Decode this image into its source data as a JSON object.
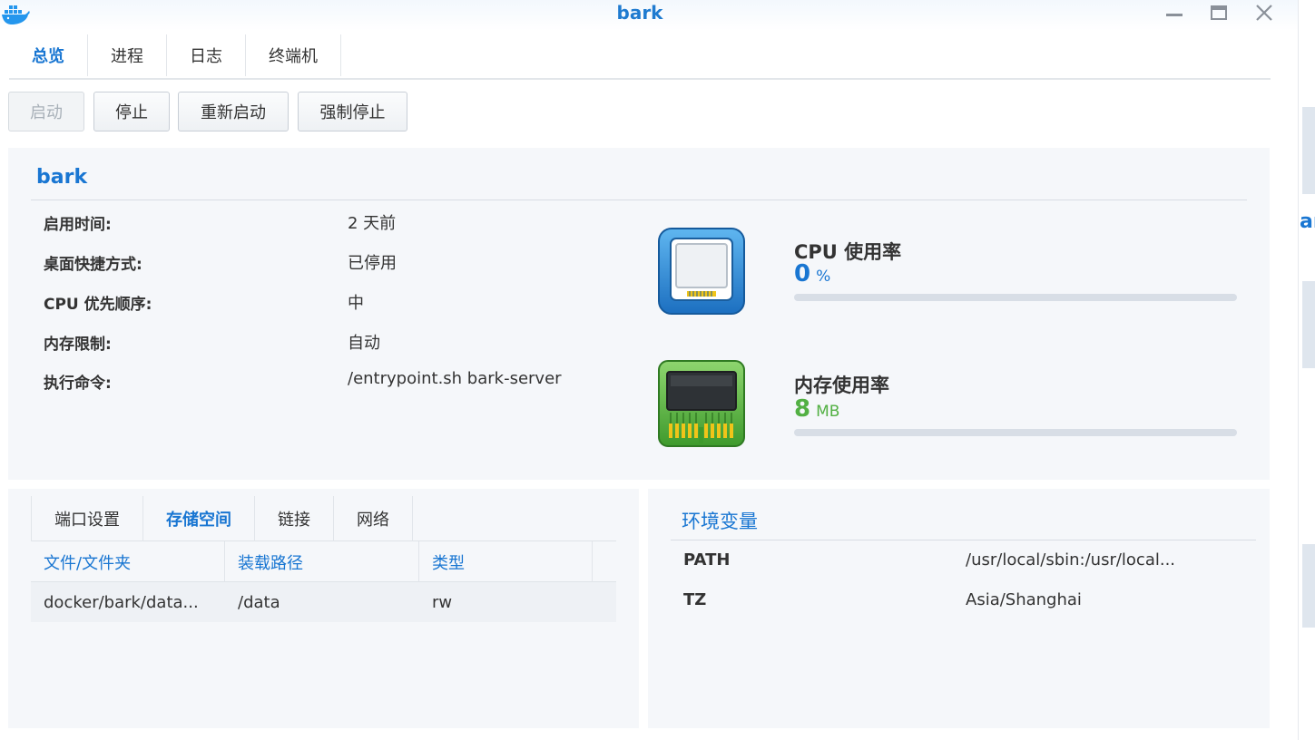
{
  "window": {
    "title": "bark",
    "app_icon": "docker-whale-icon",
    "controls": [
      "minimize-icon",
      "maximize-icon",
      "close-icon"
    ]
  },
  "tabs": [
    {
      "label": "总览",
      "active": true
    },
    {
      "label": "进程",
      "active": false
    },
    {
      "label": "日志",
      "active": false
    },
    {
      "label": "终端机",
      "active": false
    }
  ],
  "toolbar": {
    "start_label": "启动",
    "start_disabled": true,
    "stop_label": "停止",
    "restart_label": "重新启动",
    "force_stop_label": "强制停止"
  },
  "overview": {
    "name": "bark",
    "properties": [
      {
        "label": "启用时间:",
        "value": "2 天前"
      },
      {
        "label": "桌面快捷方式:",
        "value": "已停用"
      },
      {
        "label": "CPU 优先顺序:",
        "value": "中"
      },
      {
        "label": "内存限制:",
        "value": "自动"
      },
      {
        "label": "执行命令:",
        "value": "/entrypoint.sh bark-server"
      }
    ],
    "cpu": {
      "title": "CPU 使用率",
      "value": "0",
      "unit": "%",
      "percent": 0,
      "icon": "cpu-chip-icon",
      "color": "#1976d2"
    },
    "memory": {
      "title": "内存使用率",
      "value": "8",
      "unit": "MB",
      "percent": 0,
      "icon": "memory-module-icon",
      "color": "#52b043"
    }
  },
  "storage": {
    "tabs": [
      {
        "label": "端口设置",
        "active": false
      },
      {
        "label": "存储空间",
        "active": true
      },
      {
        "label": "链接",
        "active": false
      },
      {
        "label": "网络",
        "active": false
      }
    ],
    "columns": [
      "文件/文件夹",
      "装载路径",
      "类型"
    ],
    "rows": [
      {
        "file": "docker/bark/data...",
        "mount": "/data",
        "type": "rw"
      }
    ]
  },
  "environment": {
    "title": "环境变量",
    "vars": [
      {
        "key": "PATH",
        "value": "/usr/local/sbin:/usr/local..."
      },
      {
        "key": "TZ",
        "value": "Asia/Shanghai"
      }
    ]
  },
  "background": {
    "partial_text": "ar"
  },
  "colors": {
    "accent": "#1976d2",
    "memory_green": "#52b043",
    "panel_bg": "#f5f7fa"
  }
}
